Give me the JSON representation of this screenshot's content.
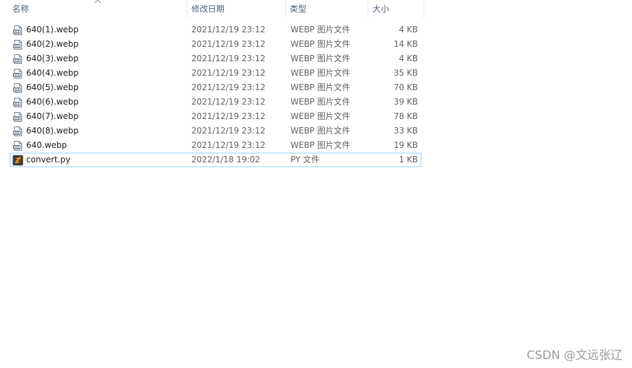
{
  "columns": {
    "name": "名称",
    "date": "修改日期",
    "type": "类型",
    "size": "大小"
  },
  "files": [
    {
      "name": "640(1).webp",
      "date": "2021/12/19 23:12",
      "type": "WEBP 图片文件",
      "size": "4 KB",
      "icon": "webp-image-icon"
    },
    {
      "name": "640(2).webp",
      "date": "2021/12/19 23:12",
      "type": "WEBP 图片文件",
      "size": "14 KB",
      "icon": "webp-image-icon"
    },
    {
      "name": "640(3).webp",
      "date": "2021/12/19 23:12",
      "type": "WEBP 图片文件",
      "size": "4 KB",
      "icon": "webp-image-icon"
    },
    {
      "name": "640(4).webp",
      "date": "2021/12/19 23:12",
      "type": "WEBP 图片文件",
      "size": "35 KB",
      "icon": "webp-image-icon"
    },
    {
      "name": "640(5).webp",
      "date": "2021/12/19 23:12",
      "type": "WEBP 图片文件",
      "size": "70 KB",
      "icon": "webp-image-icon"
    },
    {
      "name": "640(6).webp",
      "date": "2021/12/19 23:12",
      "type": "WEBP 图片文件",
      "size": "39 KB",
      "icon": "webp-image-icon"
    },
    {
      "name": "640(7).webp",
      "date": "2021/12/19 23:12",
      "type": "WEBP 图片文件",
      "size": "78 KB",
      "icon": "webp-image-icon"
    },
    {
      "name": "640(8).webp",
      "date": "2021/12/19 23:12",
      "type": "WEBP 图片文件",
      "size": "33 KB",
      "icon": "webp-image-icon"
    },
    {
      "name": "640.webp",
      "date": "2021/12/19 23:12",
      "type": "WEBP 图片文件",
      "size": "19 KB",
      "icon": "webp-image-icon"
    },
    {
      "name": "convert.py",
      "date": "2022/1/18 19:02",
      "type": "PY 文件",
      "size": "1 KB",
      "icon": "sublime-text-icon"
    }
  ],
  "watermark": "CSDN @文远张辽",
  "colors": {
    "header_text": "#4c607a",
    "selection_border": "#99d1ff",
    "image_icon": "#6d7b8c",
    "py_icon_bg": "#3a3a3a",
    "py_icon_accent": "#ff9800"
  }
}
